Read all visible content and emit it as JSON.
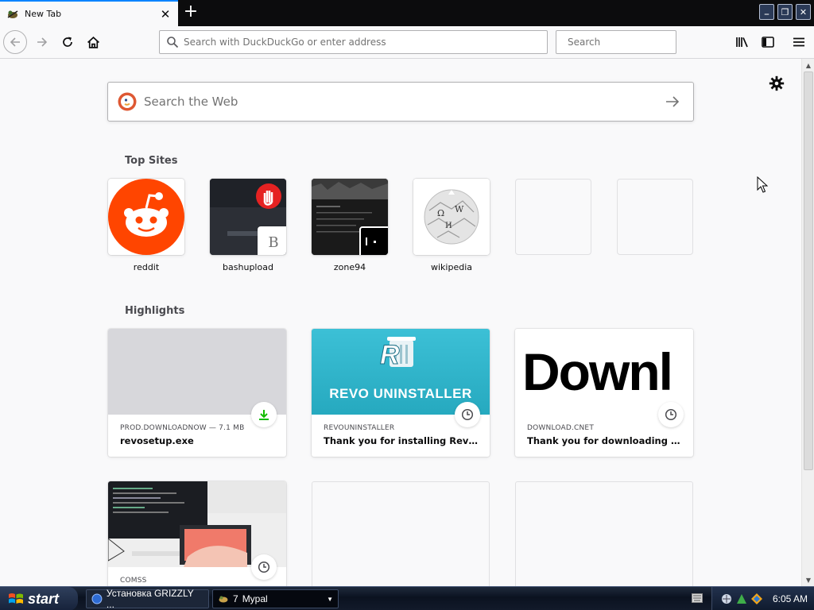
{
  "tab": {
    "title": "New Tab",
    "close": "✕"
  },
  "newtab_glyph": "+",
  "window": {
    "minimize": "_",
    "restore": "❐",
    "close": "✕"
  },
  "nav": {
    "url_placeholder": "Search with DuckDuckGo or enter address",
    "search_placeholder": "Search"
  },
  "content": {
    "websearch_placeholder": "Search the Web",
    "top_sites_title": "Top Sites",
    "highlights_title": "Highlights",
    "top_sites": [
      {
        "label": "reddit",
        "icon": "reddit-icon"
      },
      {
        "label": "bashupload",
        "icon": "bashupload-icon",
        "letter": "B"
      },
      {
        "label": "zone94",
        "icon": "zone94-icon"
      },
      {
        "label": "wikipedia",
        "icon": "wikipedia-icon"
      }
    ],
    "highlights": [
      {
        "source": "PROD.DOWNLOADNOW — 7.1 MB",
        "title": "revosetup.exe",
        "badge": "download-icon"
      },
      {
        "source": "REVOUNINSTALLER",
        "title": "Thank you for installing Revo Un...",
        "badge": "history-icon",
        "preview_text": "REVO UNINSTALLER"
      },
      {
        "source": "DOWNLOAD.CNET",
        "title": "Thank you for downloading Rev...",
        "badge": "history-icon",
        "preview_text": "Downl"
      },
      {
        "source": "COMSS",
        "title": "",
        "badge": "history-icon"
      }
    ]
  },
  "taskbar": {
    "start": "start",
    "items": [
      {
        "label": "Установка GRIZZLY ..."
      },
      {
        "label": "Mypal",
        "count": "7"
      }
    ],
    "clock": "6:05 AM"
  },
  "colors": {
    "accent": "#0a84ff",
    "reddit": "#ff4500",
    "revo_teal": "#2bb7c8",
    "download_green": "#12bc00"
  }
}
